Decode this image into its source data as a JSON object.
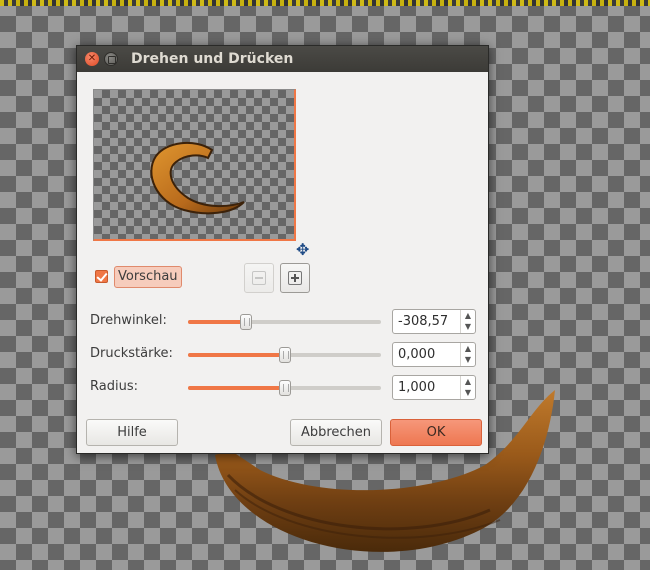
{
  "dialog": {
    "title": "Drehen und Drücken",
    "preview_label": "Vorschau",
    "preview_checked": true
  },
  "params": [
    {
      "label": "Drehwinkel:",
      "value": "-308,57",
      "slider_fraction": 0.3
    },
    {
      "label": "Druckstärke:",
      "value": "0,000",
      "slider_fraction": 0.5
    },
    {
      "label": "Radius:",
      "value": "1,000",
      "slider_fraction": 0.5
    }
  ],
  "buttons": {
    "help": "Hilfe",
    "cancel": "Abbrechen",
    "ok": "OK"
  },
  "colors": {
    "accent": "#f07746",
    "titlebar": "#3c3b37"
  },
  "icons": {
    "close": "close-icon",
    "minimize": "minimize-icon",
    "navigate": "move-cross-icon",
    "zoom_out": "zoom-out-icon",
    "zoom_in": "zoom-in-icon"
  }
}
